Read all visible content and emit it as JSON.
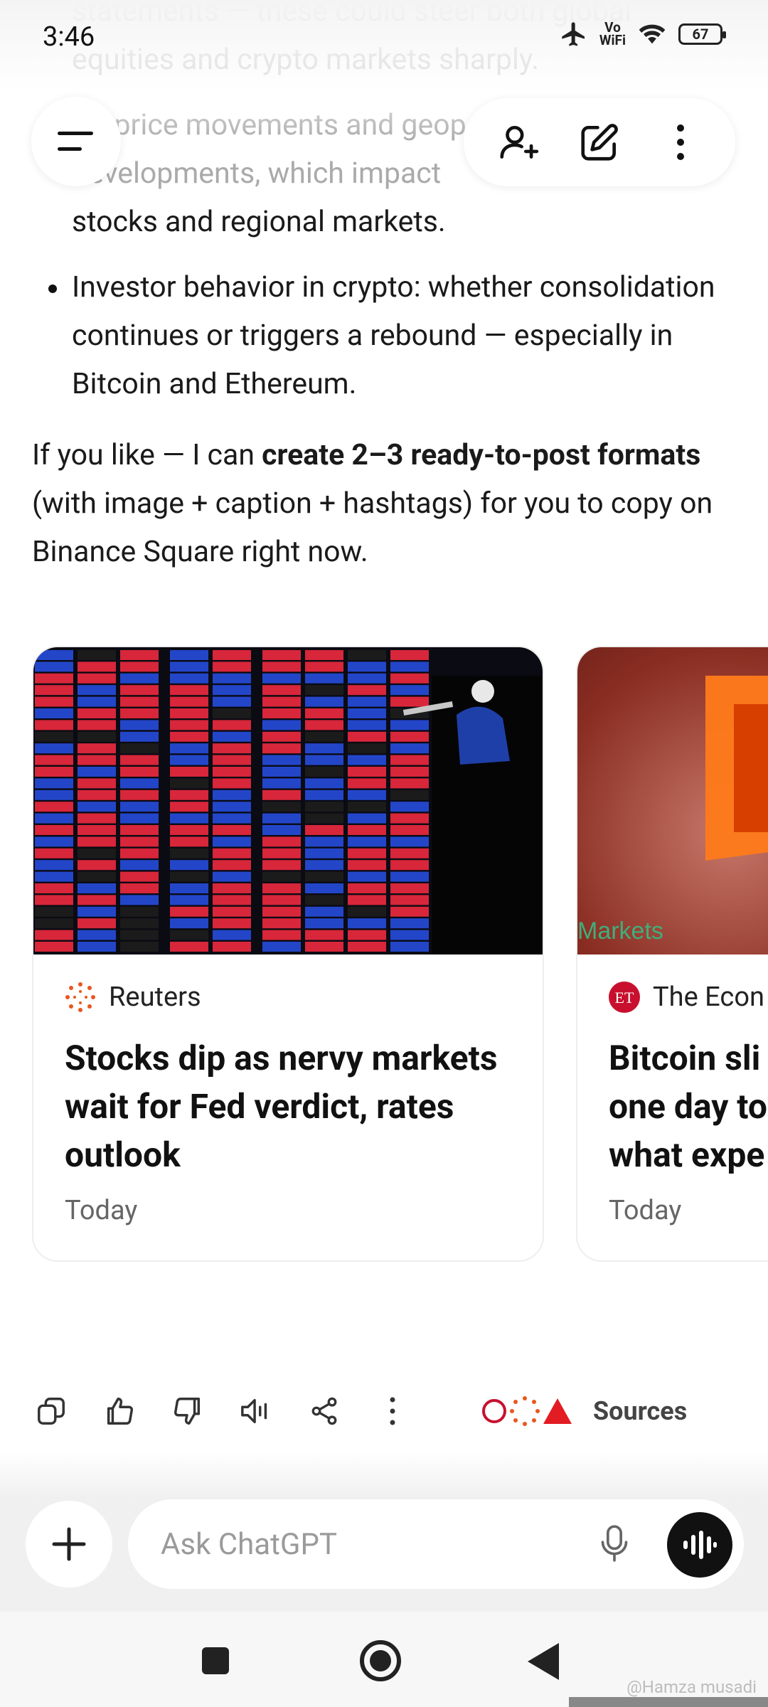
{
  "status_bar": {
    "time": "3:46",
    "vowifi": "Vo\nWiFi",
    "battery": "67"
  },
  "header": {
    "menu_icon": "menu-icon",
    "add_person_icon": "add-person-icon",
    "new_chat_icon": "edit-icon",
    "more_icon": "more-vert-icon"
  },
  "message": {
    "faded_lines": [
      "statements — these could steer both global",
      "equities and crypto markets sharply.",
      "Oil-price movements and geopolitical",
      "developments, which impact"
    ],
    "visible_line": "stocks and regional markets.",
    "bullet": "Investor behavior in crypto: whether consolidation continues or triggers a rebound — especially in Bitcoin and Ethereum.",
    "para_1": "If you like — I can ",
    "para_bold": "create 2–3 ready-to-post formats",
    "para_2": " (with image + caption + hashtags) for you to copy on Binance Square right now."
  },
  "cards": [
    {
      "source": "Reuters",
      "headline": "Stocks dip as nervy markets wait for Fed verdict, rates outlook",
      "date": "Today"
    },
    {
      "source": "The Econ",
      "headline_lines": [
        "Bitcoin sli",
        "one day to",
        "what expe"
      ],
      "image_caption": "Markets",
      "date": "Today"
    }
  ],
  "actions": {
    "icons": [
      "copy-icon",
      "thumbs-up-icon",
      "thumbs-down-icon",
      "read-aloud-icon",
      "share-icon",
      "more-icon"
    ],
    "sources_label": "Sources"
  },
  "composer": {
    "placeholder": "Ask ChatGPT"
  },
  "nav": {
    "watermark": "@Hamza musadi"
  },
  "colors": {
    "reuters_orange": "#e8571e",
    "et_red": "#c8102e"
  }
}
